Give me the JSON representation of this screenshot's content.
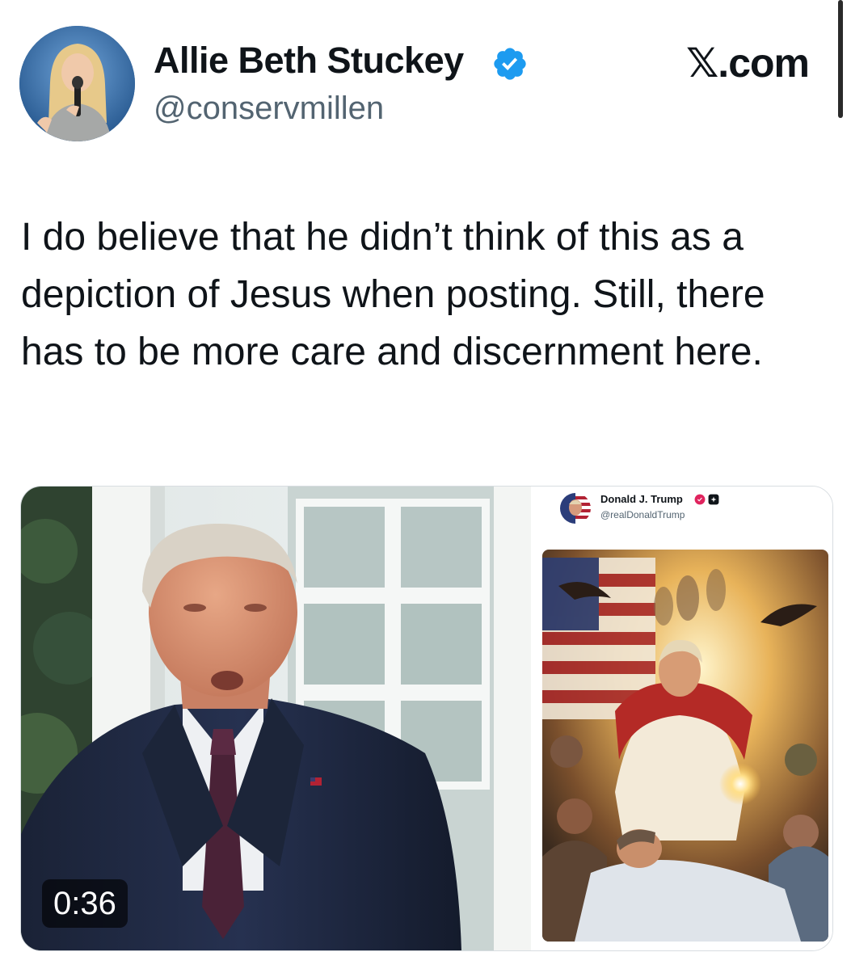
{
  "profile": {
    "display_name": "Allie Beth Stuckey",
    "handle": "@conservmillen",
    "verified": true
  },
  "brand": "𝕏.com",
  "tweet": {
    "text": "I do believe that he didn’t think of this as a depiction of Jesus when posting. Still, there has to be more care and discernment here."
  },
  "media": {
    "video": {
      "duration": "0:36"
    },
    "embedded_post": {
      "display_name": "Donald J. Trump",
      "handle": "@realDonaldTrump"
    }
  },
  "icons": {
    "verified": "verified-badge-icon",
    "mute": "muted-speaker-icon"
  },
  "colors": {
    "verified_blue": "#1d9bf0",
    "text_primary": "#0f1419",
    "text_secondary": "#536471"
  }
}
